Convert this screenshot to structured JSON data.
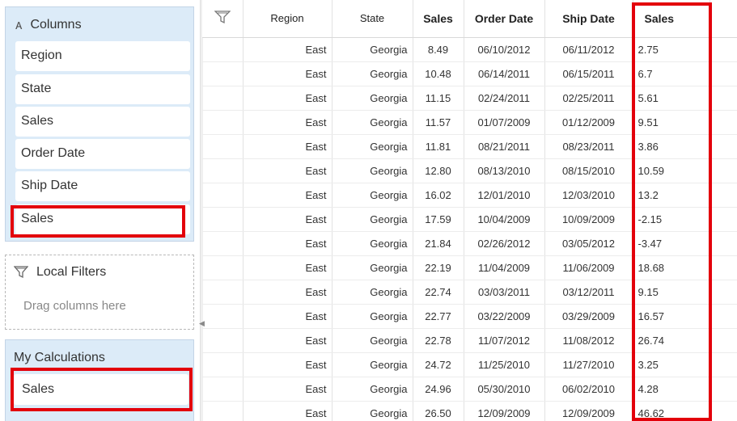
{
  "left_panel": {
    "columns_title": "Columns",
    "columns": [
      "Region",
      "State",
      "Sales",
      "Order Date",
      "Ship Date",
      "Sales"
    ],
    "filters_title": "Local Filters",
    "filters_hint": "Drag columns here",
    "calc_title": "My Calculations",
    "calc_items": [
      "Sales"
    ]
  },
  "table": {
    "headers": [
      "Region",
      "State",
      "Sales",
      "Order Date",
      "Ship Date",
      "Sales"
    ],
    "rows": [
      [
        "East",
        "Georgia",
        "8.49",
        "06/10/2012",
        "06/11/2012",
        "2.75"
      ],
      [
        "East",
        "Georgia",
        "10.48",
        "06/14/2011",
        "06/15/2011",
        "6.7"
      ],
      [
        "East",
        "Georgia",
        "11.15",
        "02/24/2011",
        "02/25/2011",
        "5.61"
      ],
      [
        "East",
        "Georgia",
        "11.57",
        "01/07/2009",
        "01/12/2009",
        "9.51"
      ],
      [
        "East",
        "Georgia",
        "11.81",
        "08/21/2011",
        "08/23/2011",
        "3.86"
      ],
      [
        "East",
        "Georgia",
        "12.80",
        "08/13/2010",
        "08/15/2010",
        "10.59"
      ],
      [
        "East",
        "Georgia",
        "16.02",
        "12/01/2010",
        "12/03/2010",
        "13.2"
      ],
      [
        "East",
        "Georgia",
        "17.59",
        "10/04/2009",
        "10/09/2009",
        "-2.15"
      ],
      [
        "East",
        "Georgia",
        "21.84",
        "02/26/2012",
        "03/05/2012",
        "-3.47"
      ],
      [
        "East",
        "Georgia",
        "22.19",
        "11/04/2009",
        "11/06/2009",
        "18.68"
      ],
      [
        "East",
        "Georgia",
        "22.74",
        "03/03/2011",
        "03/12/2011",
        "9.15"
      ],
      [
        "East",
        "Georgia",
        "22.77",
        "03/22/2009",
        "03/29/2009",
        "16.57"
      ],
      [
        "East",
        "Georgia",
        "22.78",
        "11/07/2012",
        "11/08/2012",
        "26.74"
      ],
      [
        "East",
        "Georgia",
        "24.72",
        "11/25/2010",
        "11/27/2010",
        "3.25"
      ],
      [
        "East",
        "Georgia",
        "24.96",
        "05/30/2010",
        "06/02/2010",
        "4.28"
      ],
      [
        "East",
        "Georgia",
        "26.50",
        "12/09/2009",
        "12/09/2009",
        "46.62"
      ]
    ]
  },
  "colors": {
    "highlight": "#e3000b",
    "panel_bg": "#dcebf8"
  },
  "icons": {
    "columns": "sort-letter-icon",
    "filter": "filter-icon"
  }
}
